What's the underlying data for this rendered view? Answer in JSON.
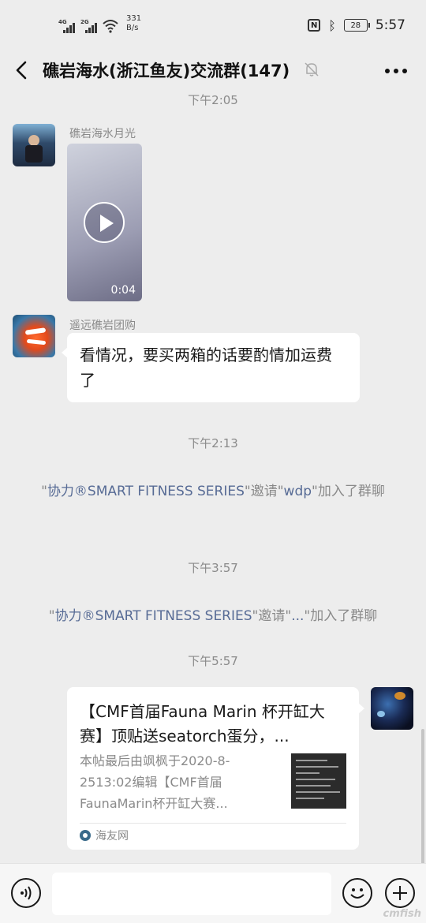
{
  "status_bar": {
    "net1_label": "4G",
    "net2_label": "2G",
    "speed_value": "331",
    "speed_unit": "B/s",
    "battery": "28",
    "time": "5:57"
  },
  "header": {
    "title": "礁岩海水(浙江鱼友)交流群(147)"
  },
  "chat": {
    "time_1": "下午2:05",
    "msg_video": {
      "sender": "礁岩海水月光",
      "duration": "0:04"
    },
    "msg_text": {
      "sender": "遥远礁岩团购",
      "text": "看情况，要买两箱的话要酌情加运费了"
    },
    "time_2": "下午2:13",
    "sys_1": {
      "q1": "\"",
      "name": "协力®SMART FITNESS SERIES",
      "mid": "\"邀请\"",
      "name2": "wdp",
      "tail": "\"加入了群聊"
    },
    "time_3": "下午3:57",
    "sys_2": {
      "q1": "\"",
      "name": "协力®SMART FITNESS SERIES",
      "mid": "\"邀请\"",
      "name2": "...",
      "tail": "\"加入了群聊"
    },
    "time_4": "下午5:57",
    "card": {
      "title": "【CMF首届Fauna Marin 杯开缸大赛】顶贴送seatorch蛋分，...",
      "desc": "本帖最后由飒枫于2020-8-2513:02编辑【CMF首届FaunaMarin杯开缸大赛...",
      "source": "海友网"
    }
  },
  "watermark": "cmfish"
}
